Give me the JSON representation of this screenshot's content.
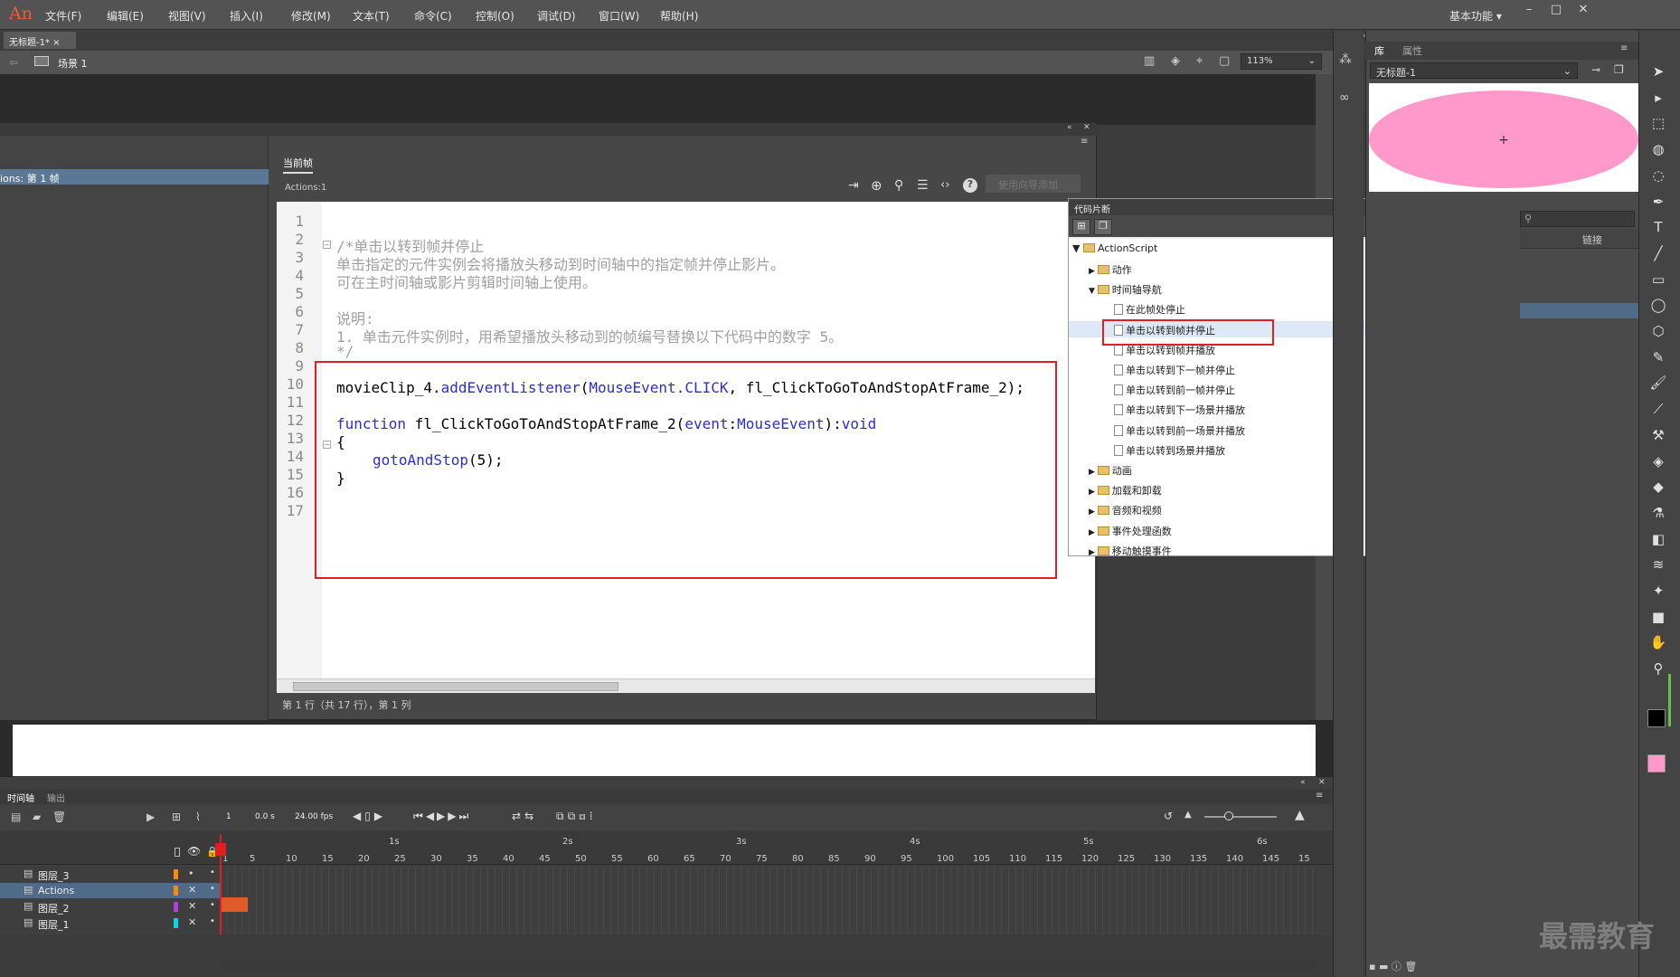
{
  "app": {
    "logo": "An"
  },
  "menu": [
    "文件(F)",
    "编辑(E)",
    "视图(V)",
    "插入(I)",
    "修改(M)",
    "文本(T)",
    "命令(C)",
    "控制(O)",
    "调试(D)",
    "窗口(W)",
    "帮助(H)"
  ],
  "workspace": "基本功能",
  "doc_tab": {
    "title": "无标题-1*",
    "close": "×"
  },
  "scene": {
    "label": "场景 1",
    "zoom": "113%"
  },
  "actions_panel": {
    "nav_item": "ions: 第 1 帧",
    "tab": "当前帧",
    "target": "Actions:1",
    "wizard_button": "使用向导添加",
    "status": "第 1 行（共 17 行），第 1 列",
    "line_numbers": [
      "1",
      "2",
      "3",
      "4",
      "5",
      "6",
      "7",
      "8",
      "9",
      "10",
      "11",
      "12",
      "13",
      "14",
      "15",
      "16",
      "17"
    ],
    "code": {
      "l3": "/*单击以转到帧并停止",
      "l4": "单击指定的元件实例会将播放头移动到时间轴中的指定帧并停止影片。",
      "l5": "可在主时间轴或影片剪辑时间轴上使用。",
      "l7": "说明:",
      "l8": "1. 单击元件实例时，用希望播放头移动到的帧编号替换以下代码中的数字 5。",
      "l9": "*/",
      "l11_obj": "movieClip_4.",
      "l11_method": "addEventListener",
      "l11_p1": "(",
      "l11_type": "MouseEvent.CLICK",
      "l11_rest": ", fl_ClickToGoToAndStopAtFrame_2);",
      "l13_kw": "function",
      "l13_name": " fl_ClickToGoToAndStopAtFrame_2(",
      "l13_param": "event",
      "l13_colon": ":",
      "l13_type": "MouseEvent",
      "l13_close": "):",
      "l13_void": "void",
      "l14": "{",
      "l15_fn": "gotoAndStop",
      "l15_rest": "(5);",
      "l16": "}"
    }
  },
  "snippets_panel": {
    "title": "代码片断",
    "root": "ActionScript",
    "items": [
      {
        "label": "动作",
        "type": "folder",
        "level": 1,
        "expanded": false
      },
      {
        "label": "时间轴导航",
        "type": "folder",
        "level": 1,
        "expanded": true
      },
      {
        "label": "在此帧处停止",
        "type": "file",
        "level": 2
      },
      {
        "label": "单击以转到帧并停止",
        "type": "file",
        "level": 2,
        "selected": true
      },
      {
        "label": "单击以转到帧并播放",
        "type": "file",
        "level": 2
      },
      {
        "label": "单击以转到下一帧并停止",
        "type": "file",
        "level": 2
      },
      {
        "label": "单击以转到前一帧并停止",
        "type": "file",
        "level": 2
      },
      {
        "label": "单击以转到下一场景并播放",
        "type": "file",
        "level": 2
      },
      {
        "label": "单击以转到前一场景并播放",
        "type": "file",
        "level": 2
      },
      {
        "label": "单击以转到场景并播放",
        "type": "file",
        "level": 2
      },
      {
        "label": "动画",
        "type": "folder",
        "level": 1,
        "expanded": false
      },
      {
        "label": "加载和卸载",
        "type": "folder",
        "level": 1,
        "expanded": false
      },
      {
        "label": "音频和视频",
        "type": "folder",
        "level": 1,
        "expanded": false
      },
      {
        "label": "事件处理函数",
        "type": "folder",
        "level": 1,
        "expanded": false
      },
      {
        "label": "移动触摸事件",
        "type": "folder",
        "level": 1,
        "expanded": false
      }
    ]
  },
  "library_panel": {
    "tab_library": "库",
    "tab_properties": "属性",
    "doc_select": "无标题-1",
    "column_link": "链接",
    "preview_color": "#ff99cc"
  },
  "timeline": {
    "tab_timeline": "时间轴",
    "tab_output": "输出",
    "current_frame": "1",
    "elapsed": "0.0 s",
    "fps": "24.00 fps",
    "seconds": [
      "1s",
      "2s",
      "3s",
      "4s",
      "5s",
      "6s"
    ],
    "frame_marks": [
      "1",
      "5",
      "10",
      "15",
      "20",
      "25",
      "30",
      "35",
      "40",
      "45",
      "50",
      "55",
      "60",
      "65",
      "70",
      "75",
      "80",
      "85",
      "90",
      "95",
      "100",
      "105",
      "110",
      "115",
      "120",
      "125",
      "130",
      "135",
      "140",
      "145",
      "15"
    ],
    "layers": [
      {
        "name": "图层_3",
        "color": "#ff8a00",
        "selected": false
      },
      {
        "name": "Actions",
        "color": "#ff8a00",
        "selected": true
      },
      {
        "name": "图层_2",
        "color": "#b040e0",
        "selected": false
      },
      {
        "name": "图层_1",
        "color": "#00d8e8",
        "selected": false
      }
    ]
  },
  "colors": {
    "stroke": "#000000",
    "fill": "#ff99cc"
  },
  "watermark": "最需教育"
}
